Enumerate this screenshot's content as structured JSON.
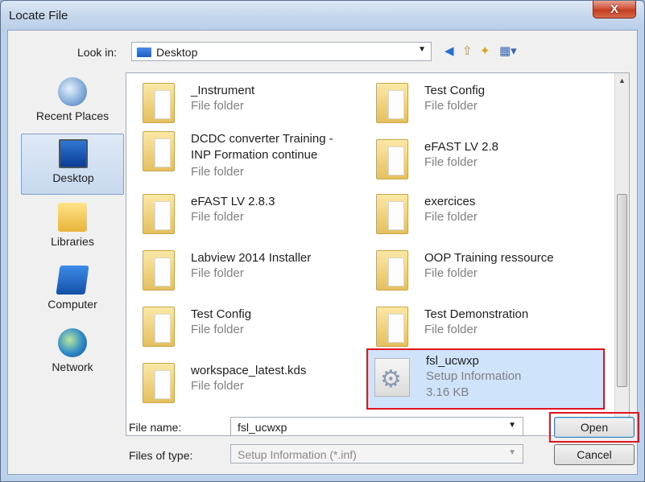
{
  "window": {
    "title": "Locate File",
    "close_label": "X"
  },
  "toolbar": {
    "lookin_label": "Look in:",
    "lookin_value": "Desktop",
    "icons": [
      "back-icon",
      "up-folder-icon",
      "new-folder-icon",
      "view-menu-icon"
    ]
  },
  "places": [
    {
      "label": "Recent Places",
      "icon": "recent-places-icon"
    },
    {
      "label": "Desktop",
      "icon": "desktop-icon",
      "selected": true
    },
    {
      "label": "Libraries",
      "icon": "libraries-icon"
    },
    {
      "label": "Computer",
      "icon": "computer-icon"
    },
    {
      "label": "Network",
      "icon": "network-icon"
    }
  ],
  "files": {
    "left": [
      {
        "name": "_Instrument",
        "type": "File folder"
      },
      {
        "name_line1": "DCDC converter Training -",
        "name_line2": "INP Formation continue",
        "type": "File folder"
      },
      {
        "name": "eFAST LV 2.8.3",
        "type": "File folder"
      },
      {
        "name": "Labview 2014 Installer",
        "type": "File folder"
      },
      {
        "name": "Test Config",
        "type": "File folder"
      },
      {
        "name": "workspace_latest.kds",
        "type": "File folder"
      }
    ],
    "right": [
      {
        "name": "Test Config",
        "type": "File folder"
      },
      {
        "name": "eFAST LV 2.8",
        "type": "File folder"
      },
      {
        "name": "exercices",
        "type": "File folder"
      },
      {
        "name": "OOP Training ressource",
        "type": "File folder"
      },
      {
        "name": "Test Demonstration",
        "type": "File folder"
      },
      {
        "name": "fsl_ucwxp",
        "type": "Setup Information",
        "size": "3.16 KB",
        "selected": true
      }
    ]
  },
  "bottom": {
    "filename_label": "File name:",
    "filename_value": "fsl_ucwxp",
    "filetype_label": "Files of type:",
    "filetype_value": "Setup Information (*.inf)",
    "open_label": "Open",
    "cancel_label": "Cancel"
  },
  "colors": {
    "selection_highlight": "#e0141e",
    "selected_bg": "#cfe4fa"
  }
}
